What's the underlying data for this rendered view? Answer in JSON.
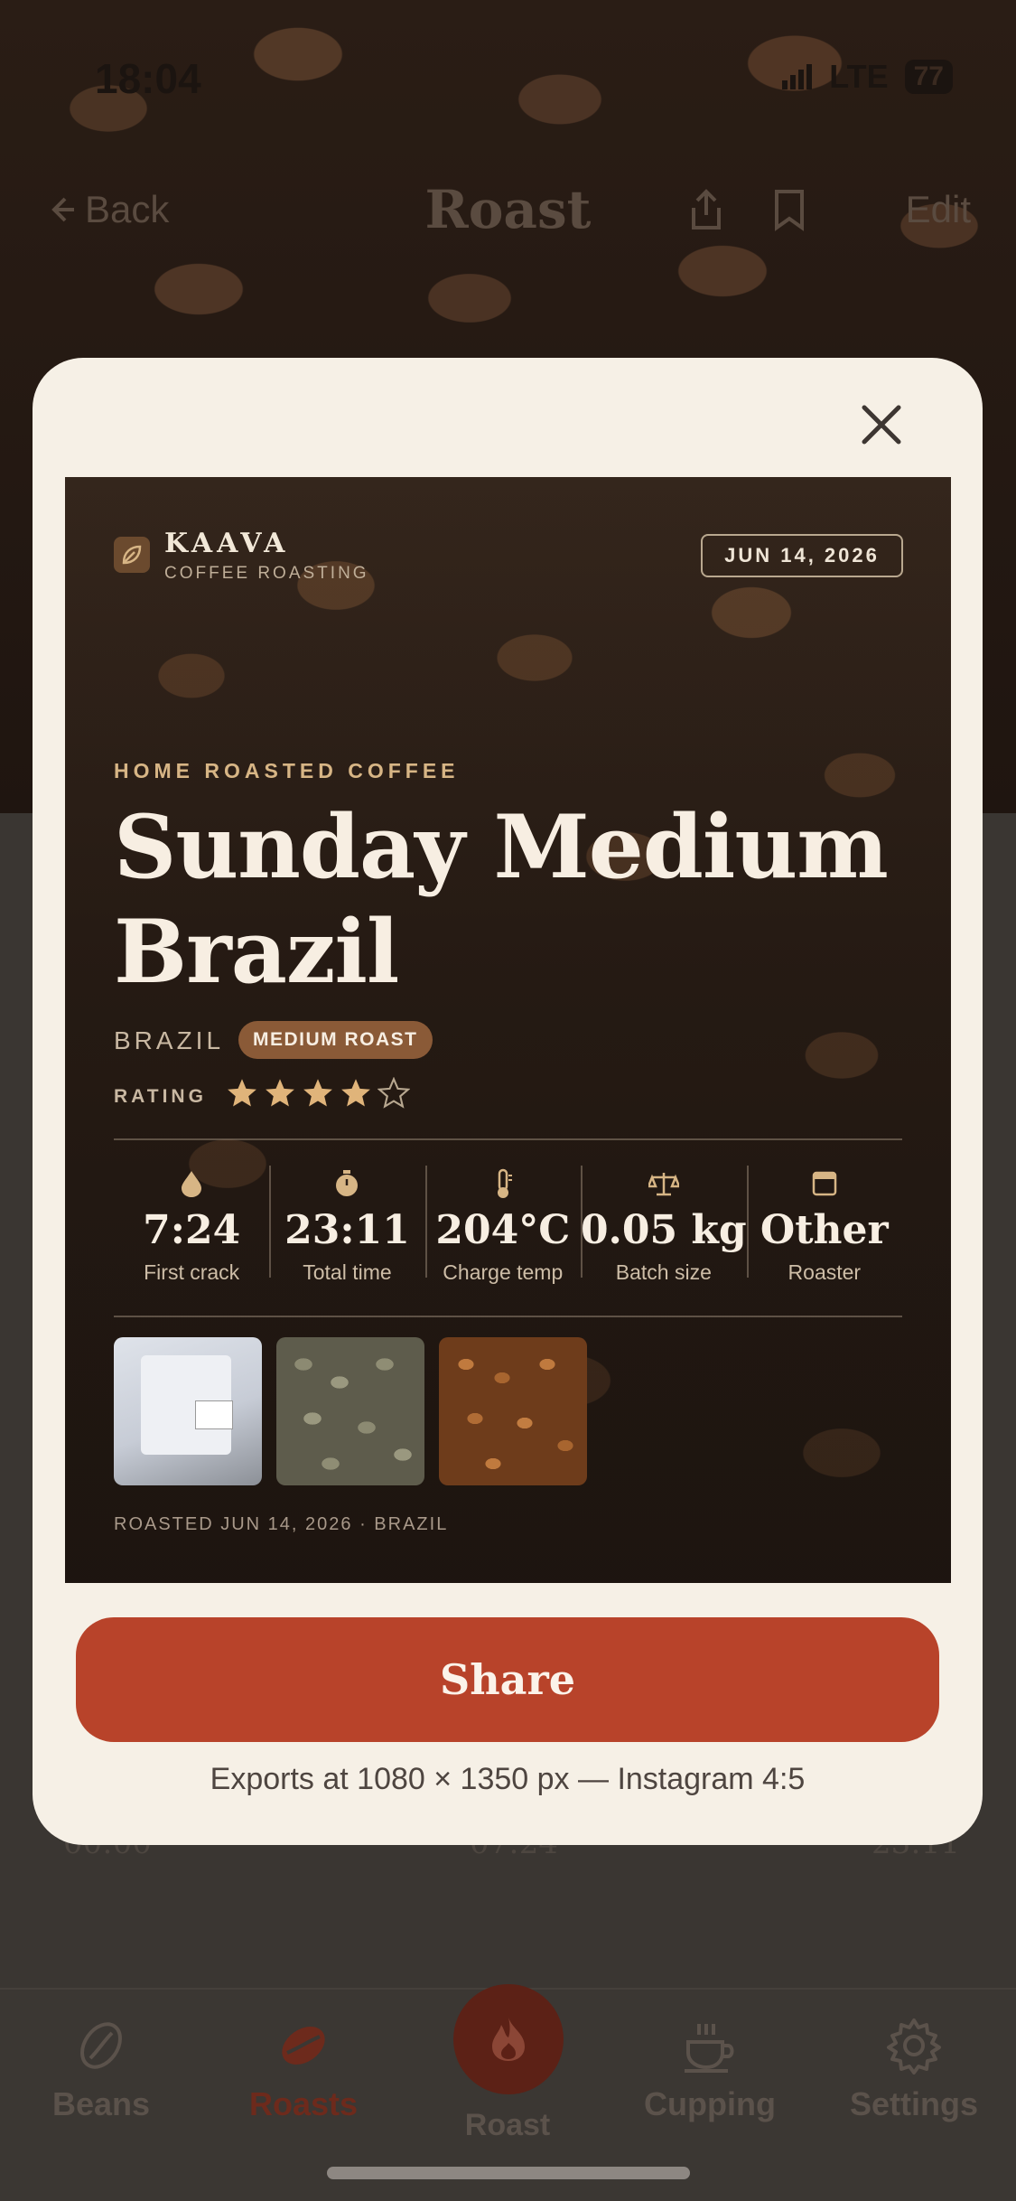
{
  "status_bar": {
    "time": "18:04",
    "network": "LTE",
    "battery": "77"
  },
  "nav": {
    "back_label": "Back",
    "title": "Roast",
    "edit_label": "Edit"
  },
  "background": {
    "time_start": "00:00",
    "time_first_crack": "07:24",
    "time_total": "23:11"
  },
  "tab_bar": {
    "items": [
      {
        "label": "Beans",
        "icon": "bean-icon"
      },
      {
        "label": "Roasts",
        "icon": "roasted-bean-icon",
        "active": true
      },
      {
        "label": "Roast",
        "icon": "flame-icon"
      },
      {
        "label": "Cupping",
        "icon": "cup-icon"
      },
      {
        "label": "Settings",
        "icon": "gear-icon"
      }
    ]
  },
  "card": {
    "brand_name": "KAAVA",
    "brand_sub": "COFFEE ROASTING",
    "date": "JUN 14, 2026",
    "kicker": "HOME ROASTED COFFEE",
    "roast_name": "Sunday Medium Brazil",
    "origin": "BRAZIL",
    "roast_level": "MEDIUM ROAST",
    "rating_label": "RATING",
    "rating": 4,
    "rating_max": 5,
    "stats": [
      {
        "icon": "drop-icon",
        "value": "7:24",
        "label": "First crack"
      },
      {
        "icon": "stopwatch-icon",
        "value": "23:11",
        "label": "Total time"
      },
      {
        "icon": "thermometer-icon",
        "value": "204°C",
        "label": "Charge temp"
      },
      {
        "icon": "scale-icon",
        "value": "0.05 kg",
        "label": "Batch size"
      },
      {
        "icon": "roaster-icon",
        "value": "Other",
        "label": "Roaster"
      }
    ],
    "photos": [
      "bag-photo",
      "green-beans-photo",
      "roasted-beans-photo"
    ],
    "footer": "ROASTED JUN 14, 2026 · BRAZIL"
  },
  "share_button_label": "Share",
  "export_note": "Exports at 1080 × 1350 px — Instagram 4:5",
  "colors": {
    "accent": "#b8432a",
    "sheet": "#f6f0e6",
    "card_text": "#f7eee2",
    "kicker": "#d7b585",
    "star": "#e0b47a"
  }
}
